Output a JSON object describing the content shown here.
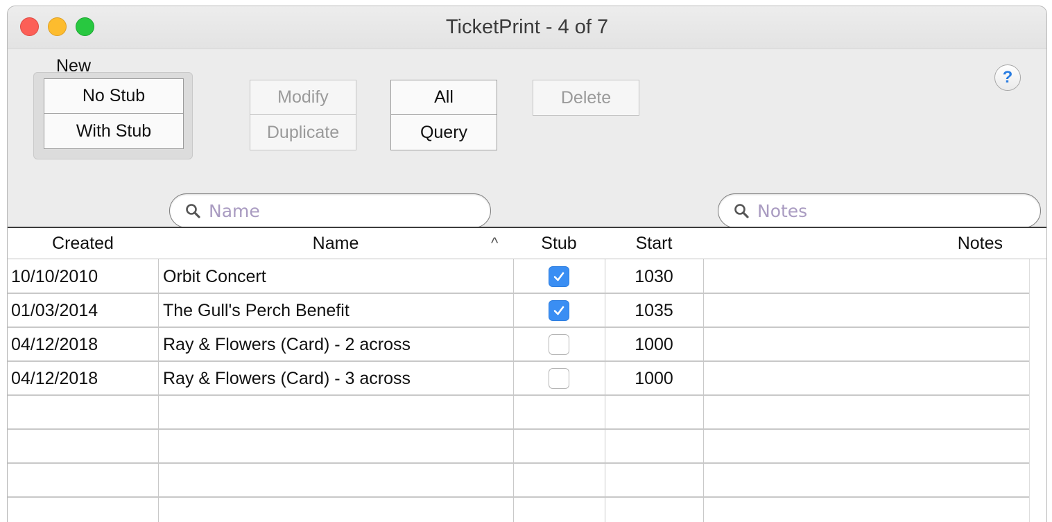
{
  "window": {
    "title": "TicketPrint - 4 of 7"
  },
  "toolbar": {
    "new_label": "New",
    "no_stub": "No Stub",
    "with_stub": "With Stub",
    "modify": "Modify",
    "duplicate": "Duplicate",
    "all": "All",
    "query": "Query",
    "delete": "Delete",
    "help": "?"
  },
  "search": {
    "name_placeholder": "Name",
    "notes_placeholder": "Notes"
  },
  "table": {
    "columns": [
      "Created",
      "Name",
      "Stub",
      "Start",
      "Notes"
    ],
    "sort_indicator": "^",
    "rows": [
      {
        "created": "10/10/2010",
        "name": "Orbit Concert",
        "stub": true,
        "start": "1030",
        "notes": ""
      },
      {
        "created": "01/03/2014",
        "name": "The Gull's Perch Benefit",
        "stub": true,
        "start": "1035",
        "notes": ""
      },
      {
        "created": "04/12/2018",
        "name": "Ray & Flowers (Card) - 2 across",
        "stub": false,
        "start": "1000",
        "notes": ""
      },
      {
        "created": "04/12/2018",
        "name": "Ray & Flowers (Card) - 3 across",
        "stub": false,
        "start": "1000",
        "notes": ""
      }
    ]
  },
  "colors": {
    "close": "#fc5f57",
    "minimize": "#fdbc2e",
    "maximize": "#28c840",
    "checkbox_checked": "#3a8ef3",
    "help_accent": "#2a7de1"
  },
  "icons": {
    "search": "search-icon",
    "help": "help-icon",
    "check": "checkmark-icon"
  }
}
